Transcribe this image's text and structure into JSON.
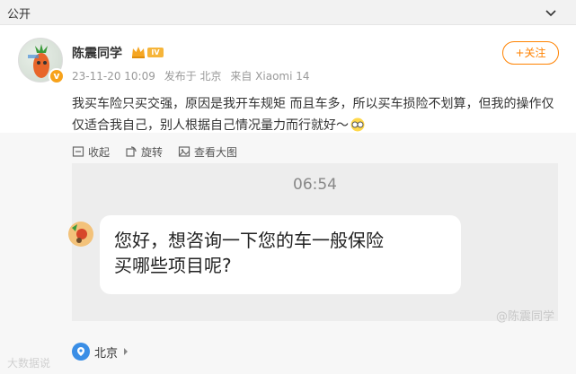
{
  "header": {
    "visibility": "公开",
    "collapse_icon": "chevron-down-icon"
  },
  "post": {
    "author": "陈震同学",
    "level_badge": "IV",
    "verified_badge": "v",
    "timestamp": "23-11-20 10:09",
    "posted_in_label": "发布于 北京",
    "source_label": "来自 Xiaomi 14",
    "follow_label": "+关注",
    "text": "我买车险只买交强，原因是我开车规矩 而且车多，所以买车损险不划算，但我的操作仅仅适合我自己，别人根据自己情况量力而行就好～"
  },
  "actions": [
    {
      "label": "收起",
      "icon": "collapse-icon"
    },
    {
      "label": "旋转",
      "icon": "rotate-icon"
    },
    {
      "label": "查看大图",
      "icon": "image-icon"
    }
  ],
  "image": {
    "chat_time": "06:54",
    "bubble_line1": "您好，想咨询一下您的车一般保险",
    "bubble_line2": "买哪些项目呢?",
    "watermark": "@陈震同学"
  },
  "location": {
    "label": "北京",
    "icon": "location-pin-icon"
  },
  "watermark_left": "大数据说",
  "colors": {
    "accent": "#ff8200",
    "pin": "#3a8ee6",
    "bg_gray": "#f7f7f7"
  }
}
